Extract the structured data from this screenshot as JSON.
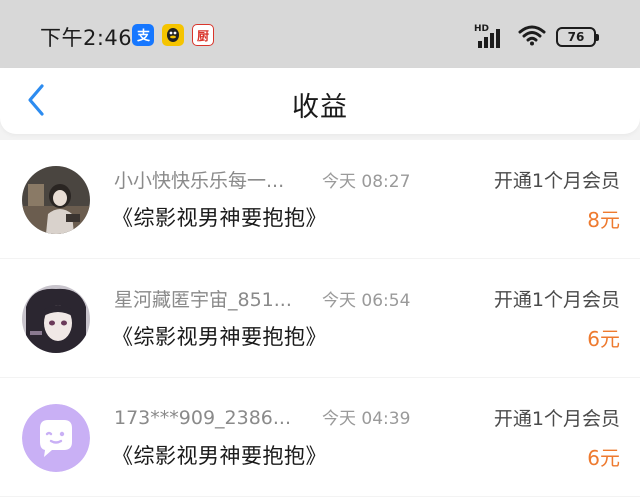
{
  "status_bar": {
    "time": "下午2:46",
    "app_icons": [
      "alipay-icon",
      "qq-icon",
      "chef-icon"
    ],
    "chef_icon_text": "厨",
    "hd_label": "HD",
    "battery": "76"
  },
  "header": {
    "title": "收益",
    "back_icon": "chevron-left-icon",
    "accent_color": "#2d8cf0"
  },
  "items": [
    {
      "name": "小小快快乐乐每一...",
      "time": "今天 08:27",
      "description": "开通1个月会员",
      "book": "《综影视男神要抱抱》",
      "amount": "8元"
    },
    {
      "name": "星河藏匿宇宙_851...",
      "time": "今天 06:54",
      "description": "开通1个月会员",
      "book": "《综影视男神要抱抱》",
      "amount": "6元"
    },
    {
      "name": "173***909_2386...",
      "time": "今天 04:39",
      "description": "开通1个月会员",
      "book": "《综影视男神要抱抱》",
      "amount": "6元"
    }
  ],
  "colors": {
    "amount": "#ee7a2f",
    "status_bar_bg": "#d8d8d8",
    "default_avatar": "#c9b0f5"
  }
}
